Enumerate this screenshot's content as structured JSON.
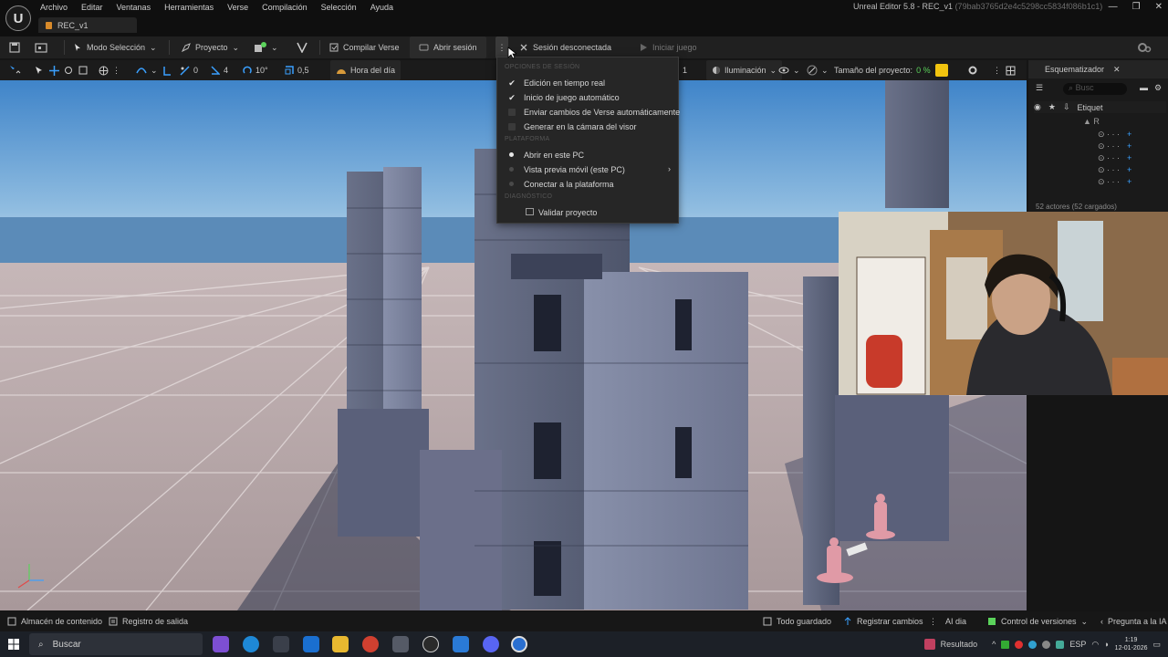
{
  "menu_bar": {
    "items": [
      "Archivo",
      "Editar",
      "Ventanas",
      "Herramientas",
      "Verse",
      "Compilación",
      "Selección",
      "Ayuda"
    ]
  },
  "window": {
    "title": "Unreal Editor 5.8 - REC_v1",
    "hash": "(79bab3765d2e4c5298cc5834f086b1c1)",
    "document_tab": "REC_v1"
  },
  "toolbar": {
    "mode": "Modo Selección",
    "project": "Proyecto",
    "compile_verse": "Compilar Verse",
    "open_session": "Abrir sesión",
    "session_status": "Sesión desconectada",
    "start_game": "Iniciar juego"
  },
  "viewport_toolbar": {
    "snap_count": "0",
    "angle_count": "4",
    "rotation": "10°",
    "scale": "0,5",
    "time_of_day": "Hora del día",
    "lighting": "Iluminación",
    "project_size_label": "Tamaño del proyecto:",
    "project_size_value": "0 %"
  },
  "dropdown": {
    "section1": "OPCIONES DE SESIÓN",
    "section2": "PLATAFORMA",
    "section3": "DIAGNÓSTICO",
    "items": [
      {
        "label": "Edición en tiempo real"
      },
      {
        "label": "Inicio de juego automático"
      },
      {
        "label": "Enviar cambios de Verse automáticamente"
      },
      {
        "label": "Generar en la cámara del visor"
      },
      {
        "label": "Abrir en este PC"
      },
      {
        "label": "Vista previa móvil (este PC)"
      },
      {
        "label": "Conectar a la plataforma"
      },
      {
        "label": "Validar proyecto"
      }
    ]
  },
  "outliner": {
    "title": "Esquematizador",
    "search_placeholder": "Busc",
    "column_label": "Etiquet",
    "footer": "52 actores (52 cargados)"
  },
  "status_bar": {
    "content_browser": "Almacén de contenido",
    "output_log": "Registro de salida",
    "all_saved": "Todo guardado",
    "register_changes": "Registrar cambios",
    "ai": "AI dia",
    "version_control": "Control de versiones",
    "ask_ai": "Pregunta a la IA"
  },
  "taskbar": {
    "search": "Buscar",
    "result": "Resultado",
    "language": "ESP",
    "time": "1:19",
    "date": "12-01-2026"
  },
  "colors": {
    "accent_blue": "#3aa0ff",
    "accent_green": "#5bd35b",
    "accent_yellow": "#f1c40f",
    "tab_orange": "#d88a2a"
  }
}
